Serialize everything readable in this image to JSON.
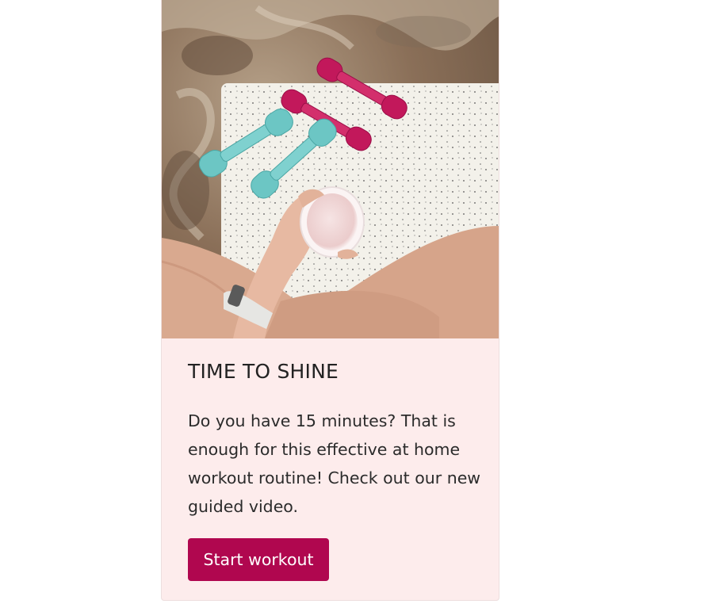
{
  "card": {
    "title": "TIME TO SHINE",
    "text": "Do you have 15 minutes? That is enough for this effective at home workout routine! Check out our new guided video.",
    "button_label": "Start workout",
    "colors": {
      "background": "#fdecec",
      "button": "#b0074f",
      "title": "#222222"
    }
  }
}
